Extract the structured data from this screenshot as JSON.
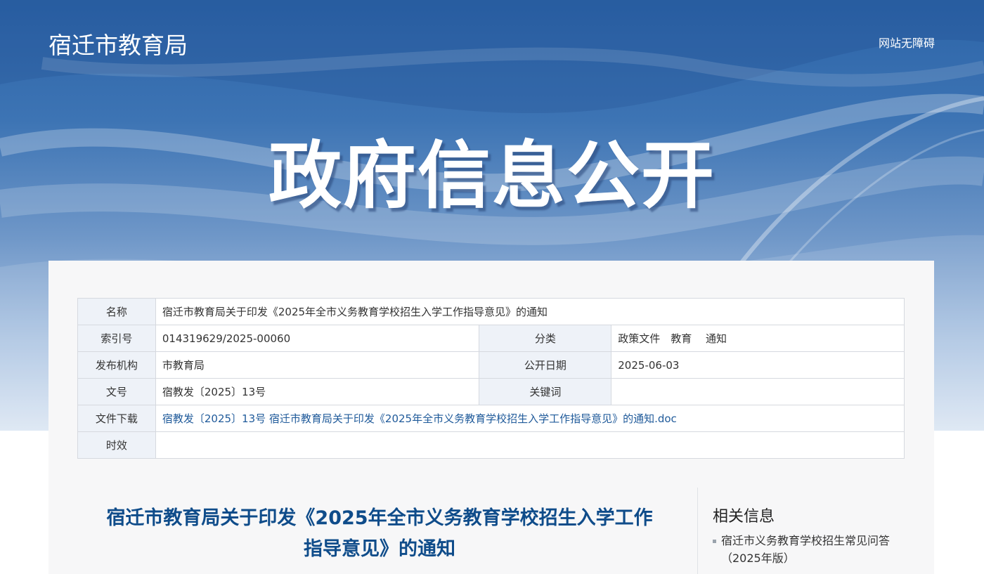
{
  "header": {
    "site_title": "宿迁市教育局",
    "accessibility_link": "网站无障碍"
  },
  "hero": {
    "title": "政府信息公开"
  },
  "info_table": {
    "name_label": "名称",
    "name_value": "宿迁市教育局关于印发《2025年全市义务教育学校招生入学工作指导意见》的通知",
    "index_label": "索引号",
    "index_value": "014319629/2025-00060",
    "category_label": "分类",
    "category_value": "政策文件　教育　 通知",
    "publisher_label": "发布机构",
    "publisher_value": "市教育局",
    "date_label": "公开日期",
    "date_value": "2025-06-03",
    "doc_number_label": "文号",
    "doc_number_value": "宿教发〔2025〕13号",
    "keywords_label": "关键词",
    "keywords_value": "",
    "download_label": "文件下载",
    "download_value": "宿教发〔2025〕13号 宿迁市教育局关于印发《2025年全市义务教育学校招生入学工作指导意见》的通知.doc",
    "validity_label": "时效",
    "validity_value": ""
  },
  "article": {
    "title_line1": "宿迁市教育局关于印发《2025年全市义务教育学校招生入学工作",
    "title_line2": "指导意见》的通知"
  },
  "related": {
    "heading": "相关信息",
    "items": [
      {
        "label_line1": "宿迁市义务教育学校招生常见问答",
        "label_line2": "（2025年版）"
      }
    ]
  },
  "colors": {
    "accent_blue": "#0f4c8a",
    "hero_top": "#2c64a8",
    "label_bg": "#eef2f8"
  }
}
